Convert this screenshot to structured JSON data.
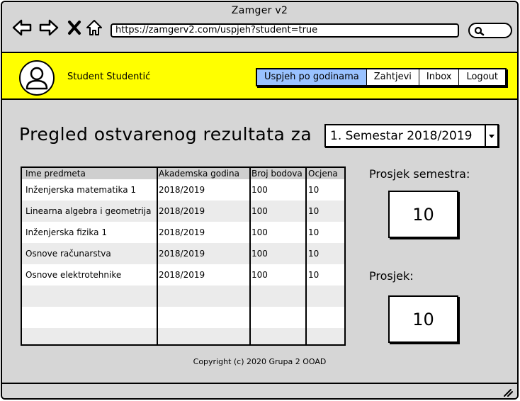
{
  "window": {
    "title": "Zamger v2"
  },
  "browser": {
    "url": "https://zamgerv2.com/uspjeh?student=true"
  },
  "header": {
    "user_name": "Student Studentić",
    "tabs": [
      {
        "label": "Uspjeh po godinama",
        "active": true
      },
      {
        "label": "Zahtjevi",
        "active": false
      },
      {
        "label": "Inbox",
        "active": false
      },
      {
        "label": "Logout",
        "active": false
      }
    ]
  },
  "main": {
    "title": "Pregled ostvarenog rezultata za",
    "semester_select": "1. Semestar 2018/2019",
    "table": {
      "headers": [
        "Ime predmeta",
        "Akademska godina",
        "Broj bodova",
        "Ocjena"
      ],
      "rows": [
        [
          "Inženjerska matematika 1",
          "2018/2019",
          "100",
          "10"
        ],
        [
          "Linearna algebra i geometrija",
          "2018/2019",
          "100",
          "10"
        ],
        [
          "Inženjerska fizika 1",
          "2018/2019",
          "100",
          "10"
        ],
        [
          "Osnove računarstva",
          "2018/2019",
          "100",
          "10"
        ],
        [
          "Osnove elektrotehnike",
          "2018/2019",
          "100",
          "10"
        ]
      ]
    },
    "semester_average": {
      "label": "Prosjek semestra:",
      "value": "10"
    },
    "overall_average": {
      "label": "Prosjek:",
      "value": "10"
    },
    "copyright": "Copyright (c) 2020 Grupa 2 OOAD"
  },
  "colors": {
    "header_bg": "#ffff00",
    "active_tab": "#99c2ff",
    "window_bg": "#d6d6d6"
  }
}
